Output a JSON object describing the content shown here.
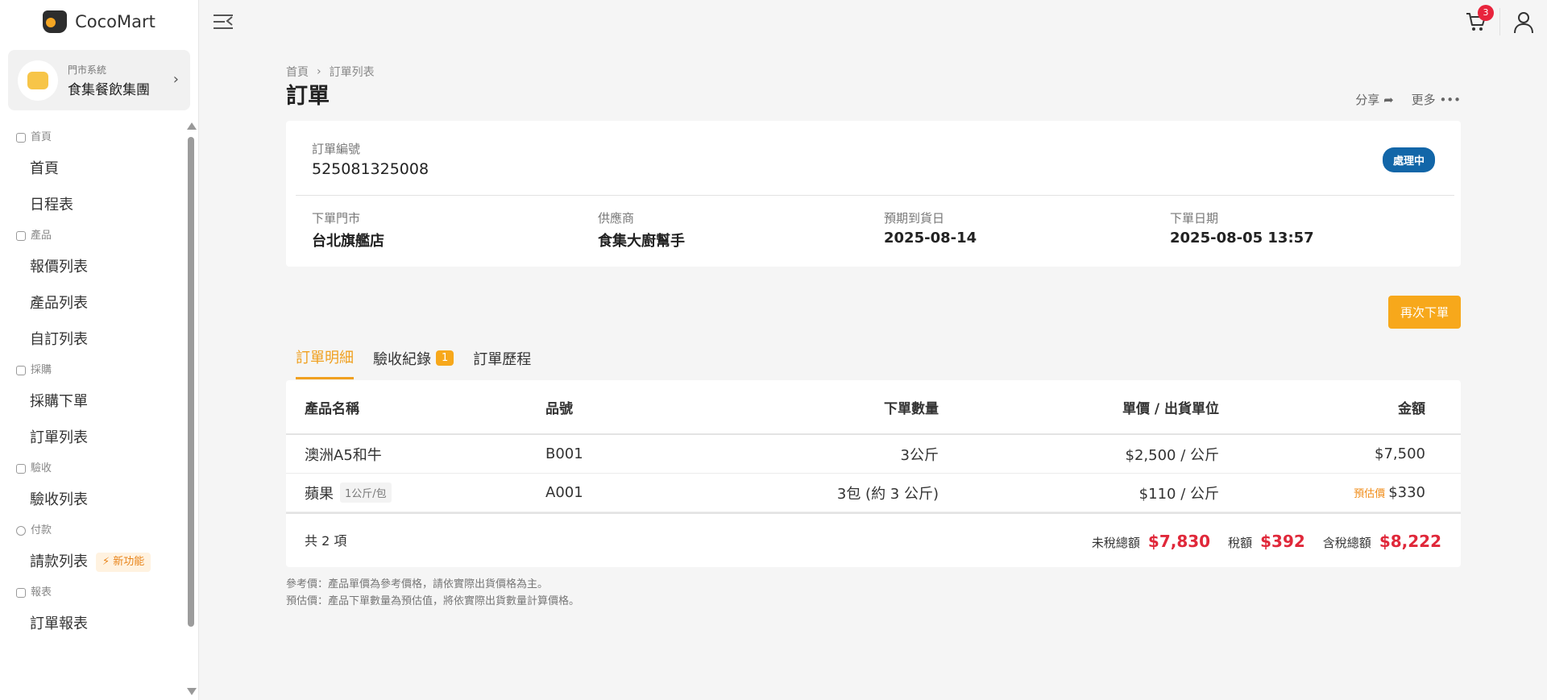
{
  "app": {
    "brand": "CocoMart"
  },
  "store": {
    "system_label": "門市系統",
    "name": "食集餐飲集團"
  },
  "sidebar": {
    "groups": [
      {
        "label": "首頁",
        "items": [
          "首頁",
          "日程表"
        ]
      },
      {
        "label": "產品",
        "items": [
          "報價列表",
          "產品列表",
          "自訂列表"
        ]
      },
      {
        "label": "採購",
        "items": [
          "採購下單",
          "訂單列表"
        ]
      },
      {
        "label": "驗收",
        "items": [
          "驗收列表"
        ]
      },
      {
        "label": "付款",
        "items": [
          "請款列表"
        ],
        "badge": "新功能"
      },
      {
        "label": "報表",
        "items": [
          "訂單報表"
        ]
      }
    ]
  },
  "topbar": {
    "cart_count": "3"
  },
  "breadcrumb": [
    "首頁",
    "訂單列表"
  ],
  "page": {
    "title": "訂單",
    "share_label": "分享",
    "more_label": "更多"
  },
  "order": {
    "number_label": "訂單編號",
    "number": "525081325008",
    "status": "處理中",
    "fields": [
      {
        "label": "下單門市",
        "value": "台北旗艦店"
      },
      {
        "label": "供應商",
        "value": "食集大廚幫手"
      },
      {
        "label": "預期到貨日",
        "value": "2025-08-14"
      },
      {
        "label": "下單日期",
        "value": "2025-08-05 13:57"
      }
    ]
  },
  "reorder_label": "再次下單",
  "tabs": [
    {
      "label": "訂單明細",
      "active": true
    },
    {
      "label": "驗收紀錄",
      "badge": "1"
    },
    {
      "label": "訂單歷程"
    }
  ],
  "table": {
    "headers": [
      "產品名稱",
      "品號",
      "下單數量",
      "單價 / 出貨單位",
      "金額"
    ],
    "rows": [
      {
        "name": "澳洲A5和牛",
        "unit_tag": "",
        "sku": "B001",
        "qty": "3公斤",
        "price": "$2,500 / 公斤",
        "est_tag": "",
        "amount": "$7,500"
      },
      {
        "name": "蘋果",
        "unit_tag": "1公斤/包",
        "sku": "A001",
        "qty": "3包 (約 3 公斤)",
        "price": "$110 / 公斤",
        "est_tag": "預估價",
        "amount": "$330"
      }
    ],
    "count_text": "共 2 項",
    "totals": {
      "pretax_label": "未稅總額",
      "pretax": "$7,830",
      "tax_label": "稅額",
      "tax": "$392",
      "total_label": "含稅總額",
      "total": "$8,222"
    }
  },
  "notes": [
    "參考價：產品單價為參考價格，請依實際出貨價格為主。",
    "預估價：產品下單數量為預估值，將依實際出貨數量計算價格。"
  ]
}
